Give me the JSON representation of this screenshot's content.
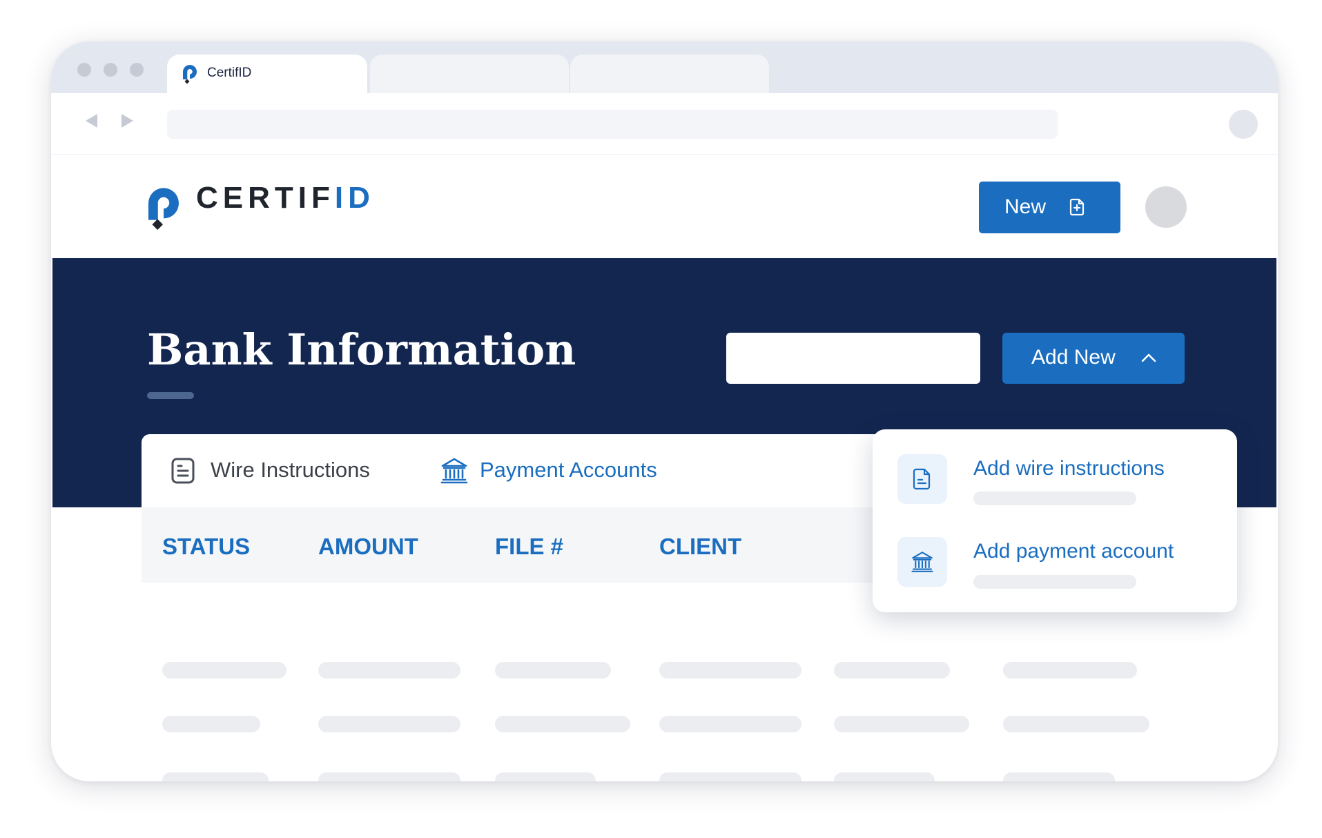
{
  "browser": {
    "tab_title": "CertifID"
  },
  "header": {
    "logo_part1": "CERTIF",
    "logo_part2": "ID",
    "new_button_label": "New"
  },
  "hero": {
    "title": "Bank Information",
    "search_value": "",
    "add_new_label": "Add New"
  },
  "tabs": [
    {
      "label": "Wire Instructions",
      "active": false,
      "icon": "document-list-icon"
    },
    {
      "label": "Payment Accounts",
      "active": true,
      "icon": "bank-icon"
    }
  ],
  "table": {
    "columns": [
      "STATUS",
      "AMOUNT",
      "FILE #",
      "CLIENT"
    ]
  },
  "dropdown": {
    "items": [
      {
        "label": "Add wire instructions",
        "icon": "document-icon"
      },
      {
        "label": "Add payment account",
        "icon": "bank-icon"
      }
    ]
  },
  "colors": {
    "brand_blue": "#1a6dbf",
    "navy": "#132650",
    "skeleton": "#ebedf0"
  }
}
